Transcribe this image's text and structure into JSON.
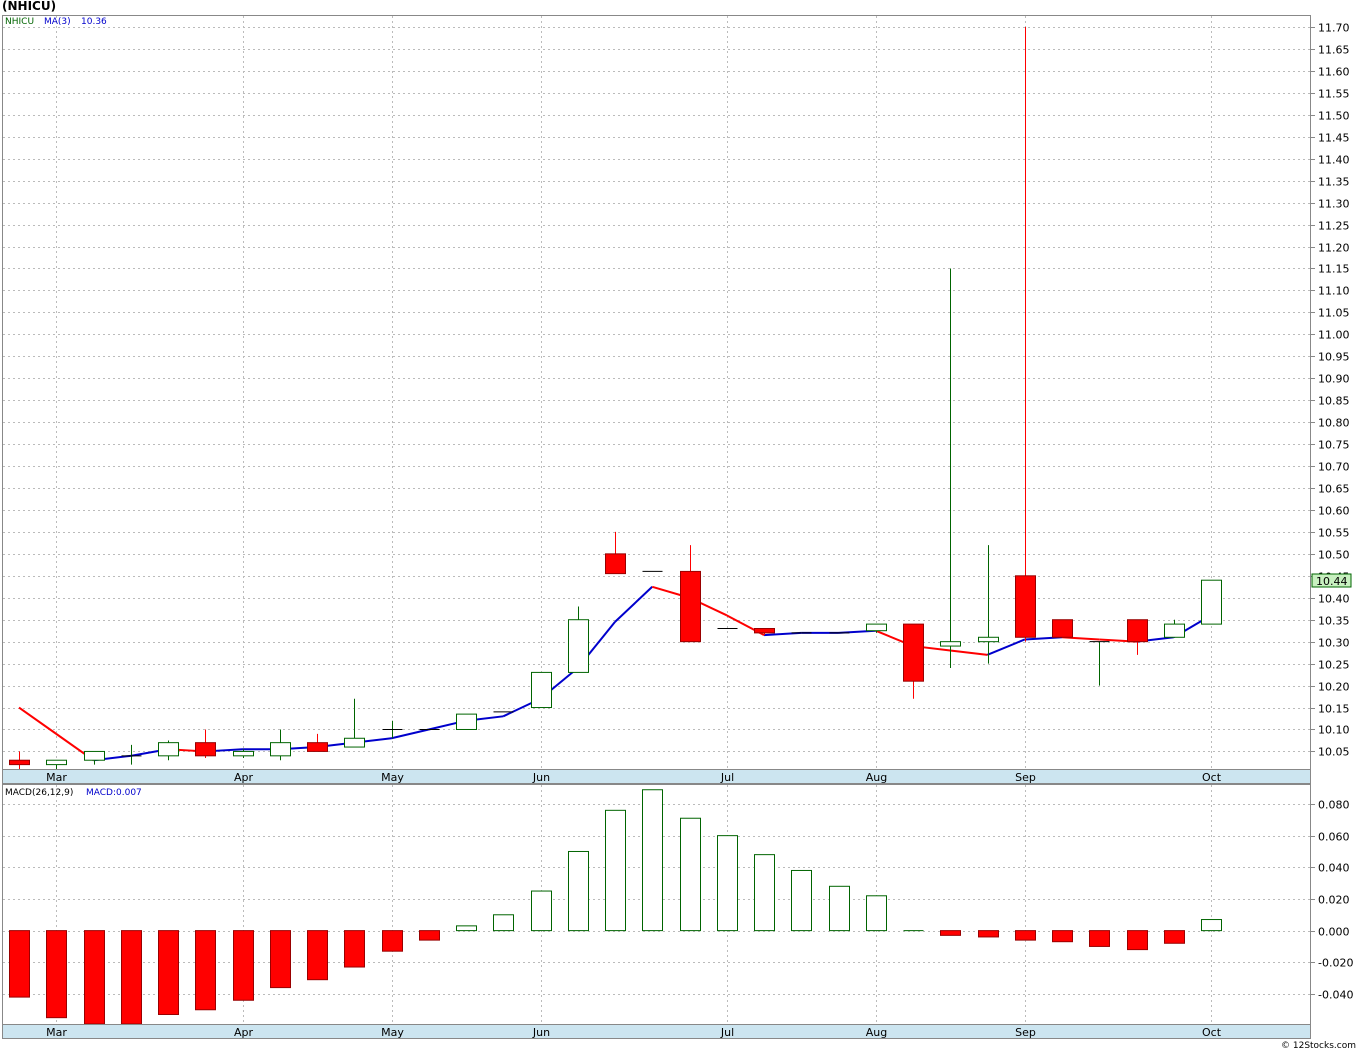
{
  "title": "(NHICU)",
  "copyright": "© 12Stocks.com",
  "price_panel": {
    "legend": {
      "symbol": "NHICU",
      "ma_label": "MA(3)",
      "ma_value": "10.36"
    },
    "last_price_label": "10.44"
  },
  "macd_panel": {
    "legend": {
      "label": "MACD(26,12,9)",
      "value_label": "MACD:0.007"
    }
  },
  "colors": {
    "up_candle": "#006400",
    "down_candle": "#ff0000",
    "ma_rising": "#0000cc",
    "ma_falling": "#ff0000",
    "axis_band": "#cce5f0",
    "last_price_bg": "#c8f0c0"
  },
  "chart_data": [
    {
      "type": "candlestick",
      "title": "(NHICU)",
      "interval": "weekly",
      "ylim": [
        10.01,
        11.725
      ],
      "y_ticks": [
        "10.05",
        "10.10",
        "10.15",
        "10.20",
        "10.25",
        "10.30",
        "10.35",
        "10.40",
        "10.45",
        "10.50",
        "10.55",
        "10.60",
        "10.65",
        "10.70",
        "10.75",
        "10.80",
        "10.85",
        "10.90",
        "10.95",
        "11.00",
        "11.05",
        "11.10",
        "11.15",
        "11.20",
        "11.25",
        "11.30",
        "11.35",
        "11.40",
        "11.45",
        "11.50",
        "11.55",
        "11.60",
        "11.65",
        "11.70"
      ],
      "x_month_labels": [
        {
          "label": "Mar",
          "index": 1
        },
        {
          "label": "Apr",
          "index": 6
        },
        {
          "label": "May",
          "index": 10
        },
        {
          "label": "Jun",
          "index": 14
        },
        {
          "label": "Jul",
          "index": 19
        },
        {
          "label": "Aug",
          "index": 23
        },
        {
          "label": "Sep",
          "index": 27
        },
        {
          "label": "Oct",
          "index": 32
        }
      ],
      "ohlc": [
        {
          "o": 10.03,
          "h": 10.05,
          "l": 10.0,
          "c": 10.02
        },
        {
          "o": 10.02,
          "h": 10.03,
          "l": 10.0,
          "c": 10.03
        },
        {
          "o": 10.03,
          "h": 10.05,
          "l": 10.02,
          "c": 10.05
        },
        {
          "o": 10.04,
          "h": 10.065,
          "l": 10.02,
          "c": 10.04
        },
        {
          "o": 10.04,
          "h": 10.075,
          "l": 10.03,
          "c": 10.07
        },
        {
          "o": 10.07,
          "h": 10.1,
          "l": 10.035,
          "c": 10.04
        },
        {
          "o": 10.04,
          "h": 10.055,
          "l": 10.035,
          "c": 10.05
        },
        {
          "o": 10.04,
          "h": 10.1,
          "l": 10.03,
          "c": 10.07
        },
        {
          "o": 10.07,
          "h": 10.09,
          "l": 10.05,
          "c": 10.05
        },
        {
          "o": 10.06,
          "h": 10.17,
          "l": 10.06,
          "c": 10.08
        },
        {
          "o": 10.1,
          "h": 10.12,
          "l": 10.08,
          "c": 10.1
        },
        {
          "o": 10.1,
          "h": 10.1,
          "l": 10.1,
          "c": 10.1
        },
        {
          "o": 10.1,
          "h": 10.135,
          "l": 10.1,
          "c": 10.135
        },
        {
          "o": 10.14,
          "h": 10.14,
          "l": 10.14,
          "c": 10.14
        },
        {
          "o": 10.15,
          "h": 10.23,
          "l": 10.15,
          "c": 10.23
        },
        {
          "o": 10.23,
          "h": 10.38,
          "l": 10.23,
          "c": 10.35
        },
        {
          "o": 10.5,
          "h": 10.55,
          "l": 10.455,
          "c": 10.455
        },
        {
          "o": 10.46,
          "h": 10.46,
          "l": 10.46,
          "c": 10.46
        },
        {
          "o": 10.46,
          "h": 10.52,
          "l": 10.3,
          "c": 10.3
        },
        {
          "o": 10.33,
          "h": 10.33,
          "l": 10.33,
          "c": 10.33
        },
        {
          "o": 10.33,
          "h": 10.33,
          "l": 10.315,
          "c": 10.32
        },
        {
          "o": 10.32,
          "h": 10.32,
          "l": 10.32,
          "c": 10.32
        },
        {
          "o": 10.32,
          "h": 10.32,
          "l": 10.32,
          "c": 10.32
        },
        {
          "o": 10.325,
          "h": 10.34,
          "l": 10.32,
          "c": 10.34
        },
        {
          "o": 10.34,
          "h": 10.34,
          "l": 10.17,
          "c": 10.21
        },
        {
          "o": 10.29,
          "h": 11.15,
          "l": 10.24,
          "c": 10.3
        },
        {
          "o": 10.3,
          "h": 10.52,
          "l": 10.25,
          "c": 10.31
        },
        {
          "o": 10.45,
          "h": 11.7,
          "l": 10.3,
          "c": 10.31
        },
        {
          "o": 10.35,
          "h": 10.35,
          "l": 10.31,
          "c": 10.31
        },
        {
          "o": 10.3,
          "h": 10.3,
          "l": 10.2,
          "c": 10.3
        },
        {
          "o": 10.35,
          "h": 10.35,
          "l": 10.27,
          "c": 10.3
        },
        {
          "o": 10.31,
          "h": 10.35,
          "l": 10.31,
          "c": 10.34
        },
        {
          "o": 10.34,
          "h": 10.44,
          "l": 10.34,
          "c": 10.44
        }
      ],
      "ma3": [
        10.15,
        10.09,
        10.03,
        10.04,
        10.055,
        10.05,
        10.055,
        10.055,
        10.06,
        10.07,
        10.08,
        10.1,
        10.12,
        10.13,
        10.17,
        10.24,
        10.345,
        10.425,
        10.4,
        10.36,
        10.315,
        10.32,
        10.32,
        10.325,
        10.29,
        10.28,
        10.27,
        10.305,
        10.31,
        10.305,
        10.3,
        10.31,
        10.36
      ]
    },
    {
      "type": "bar",
      "title": "MACD(26,12,9)",
      "ylim": [
        -0.059,
        0.092
      ],
      "y_ticks": [
        "-0.040",
        "-0.020",
        "0.000",
        "0.020",
        "0.040",
        "0.060",
        "0.080"
      ],
      "values": [
        -0.042,
        -0.055,
        -0.059,
        -0.059,
        -0.053,
        -0.05,
        -0.044,
        -0.036,
        -0.031,
        -0.023,
        -0.013,
        -0.006,
        0.003,
        0.01,
        0.025,
        0.05,
        0.076,
        0.089,
        0.071,
        0.06,
        0.048,
        0.038,
        0.028,
        0.022,
        0.0,
        -0.003,
        -0.004,
        -0.006,
        -0.007,
        -0.01,
        -0.012,
        -0.008,
        0.007
      ]
    }
  ]
}
